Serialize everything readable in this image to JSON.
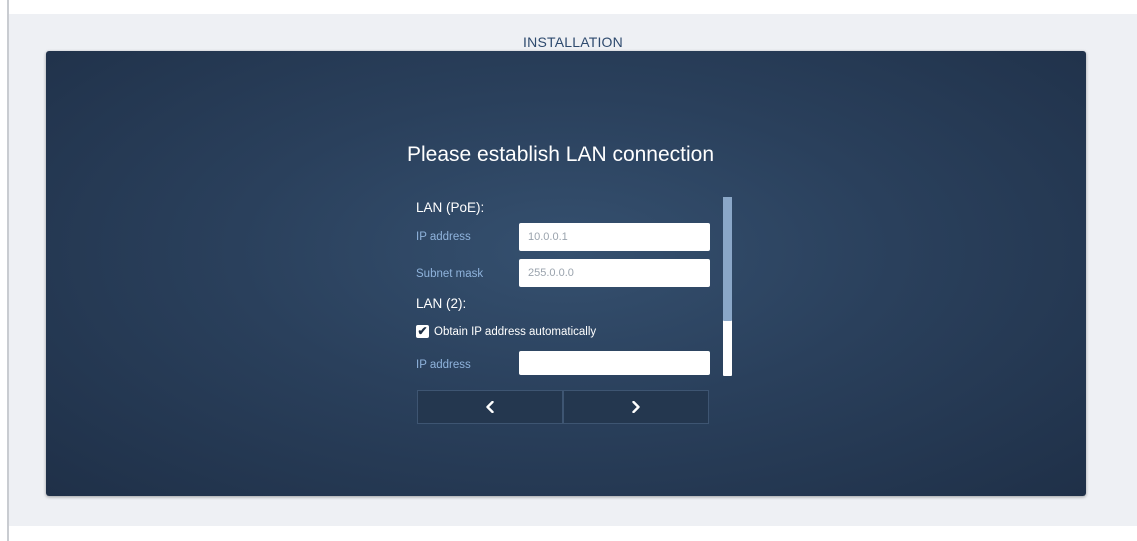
{
  "header": {
    "title": "INSTALLATION"
  },
  "dialog": {
    "heading": "Please establish LAN connection",
    "lan_poe": {
      "title": "LAN (PoE):",
      "ip_label": "IP address",
      "ip_value": "10.0.0.1",
      "mask_label": "Subnet mask",
      "mask_value": "255.0.0.0"
    },
    "lan2": {
      "title": "LAN (2):",
      "auto_label": "Obtain IP address automatically",
      "auto_checked": true,
      "ip_label": "IP address",
      "ip_value": ""
    },
    "nav": {
      "prev_icon": "chevron-left-icon",
      "next_icon": "chevron-right-icon"
    }
  },
  "colors": {
    "panel": "#2a405c",
    "label": "#8fb3dc",
    "frame_bg": "#eef0f4",
    "title": "#2e4a6e",
    "scroll_thumb": "#8aa7c8"
  }
}
